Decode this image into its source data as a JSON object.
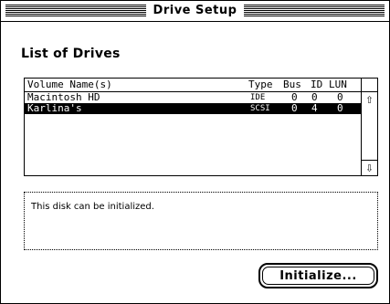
{
  "window": {
    "title": "Drive Setup"
  },
  "section": {
    "title": "List of Drives"
  },
  "list": {
    "columns": [
      "Volume Name(s)",
      "Type",
      "Bus",
      "ID",
      "LUN"
    ],
    "rows": [
      {
        "name": "Macintosh HD",
        "type": "IDE",
        "bus": "0",
        "id": "0",
        "lun": "0",
        "selected": false
      },
      {
        "name": "Karlina's",
        "type": "SCSI",
        "bus": "0",
        "id": "4",
        "lun": "0",
        "selected": true
      }
    ],
    "scroll_up_icon": "up-arrow-icon",
    "scroll_down_icon": "down-arrow-icon"
  },
  "status": {
    "message": "This disk can be initialized."
  },
  "button": {
    "label": "Initialize..."
  }
}
